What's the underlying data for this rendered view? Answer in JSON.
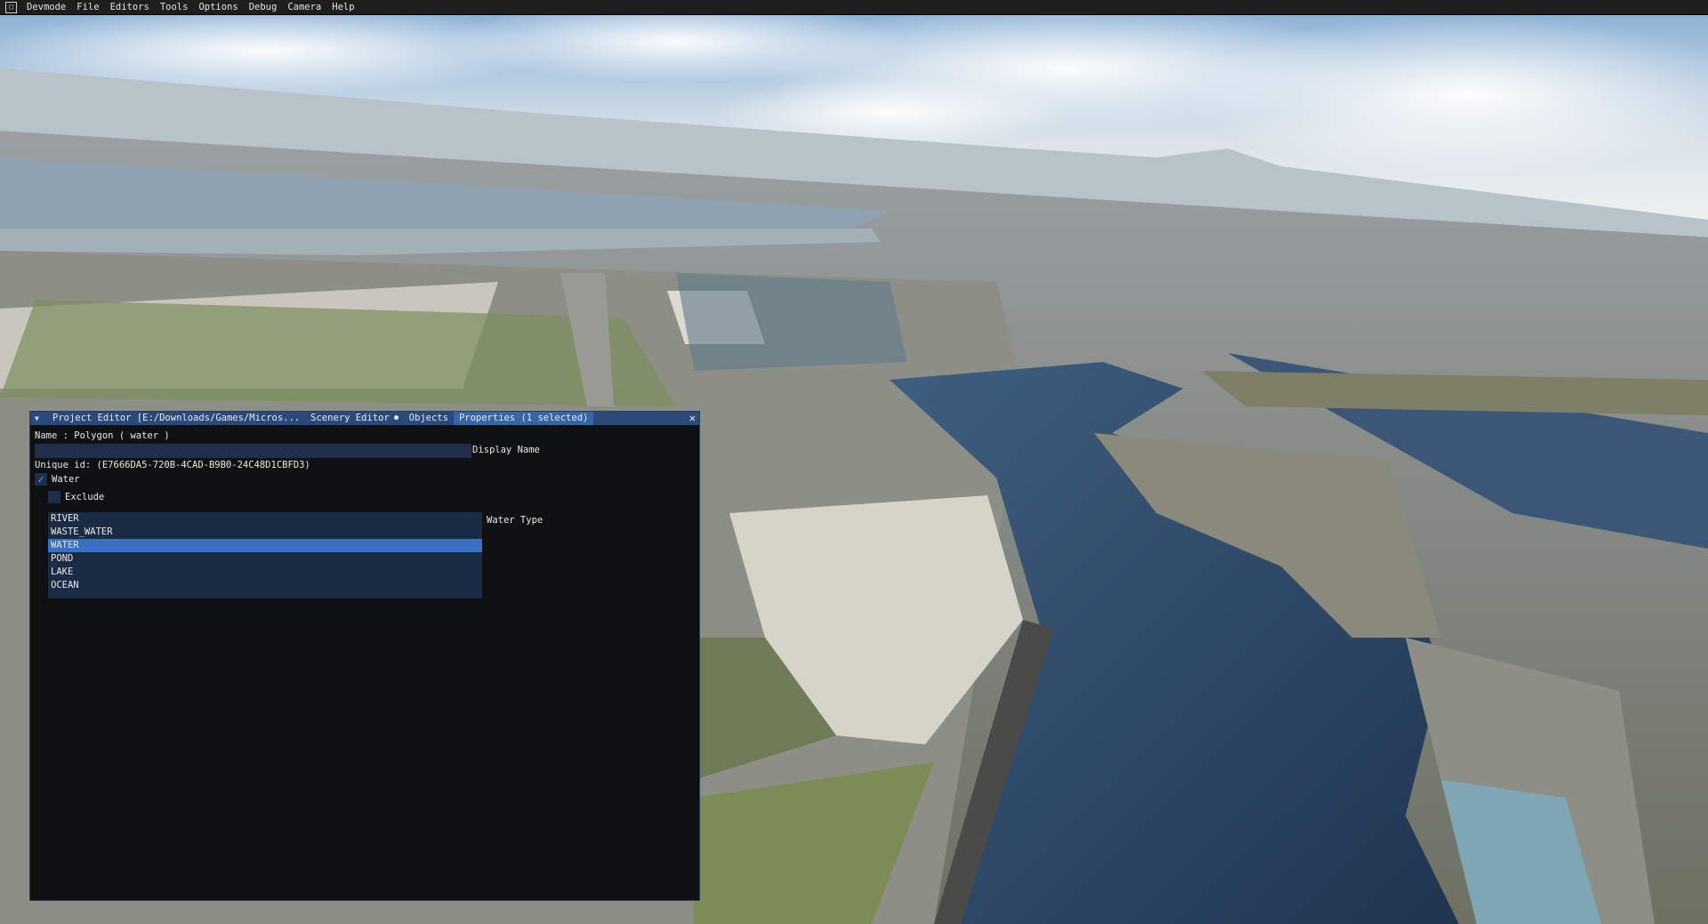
{
  "menubar": {
    "items": [
      "Devmode",
      "File",
      "Editors",
      "Tools",
      "Options",
      "Debug",
      "Camera",
      "Help"
    ]
  },
  "editor": {
    "tabs": [
      {
        "label": "Project Editor [E:/Downloads/Games/Micros...",
        "active": false,
        "dot": false
      },
      {
        "label": "Scenery Editor",
        "active": false,
        "dot": true
      },
      {
        "label": "Objects",
        "active": false,
        "dot": false
      },
      {
        "label": "Properties (1 selected)",
        "active": true,
        "dot": false
      }
    ],
    "name_line": "Name : Polygon  ( water )",
    "display_name_value": "",
    "display_name_label": "Display Name",
    "unique_id": "Unique id: (E7666DA5-720B-4CAD-B9B0-24C48D1CBFD3)",
    "water_checkbox": {
      "label": "Water",
      "checked": true
    },
    "exclude_checkbox": {
      "label": "Exclude",
      "checked": false
    },
    "water_type_label": "Water Type",
    "water_types": [
      "RIVER",
      "WASTE_WATER",
      "WATER",
      "POND",
      "LAKE",
      "OCEAN"
    ],
    "water_type_selected": "WATER"
  },
  "colors": {
    "menubar_bg": "#1e1e1e",
    "title_bg": "#294a7a",
    "active_tab": "#3566a8",
    "panel_bg": "#0f1011",
    "frame_bg": "#1d2f4a",
    "selection": "#3a70c2"
  }
}
